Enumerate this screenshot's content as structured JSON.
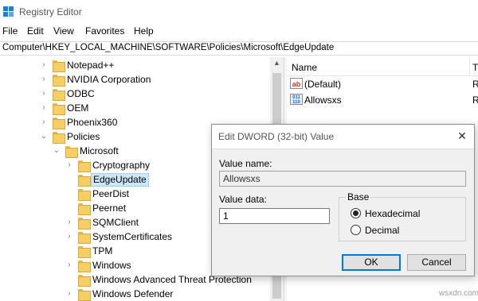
{
  "window": {
    "title": "Registry Editor"
  },
  "menu": [
    "File",
    "Edit",
    "View",
    "Favorites",
    "Help"
  ],
  "address": "Computer\\HKEY_LOCAL_MACHINE\\SOFTWARE\\Policies\\Microsoft\\EdgeUpdate",
  "tree": [
    {
      "label": "Notepad++",
      "level": 1,
      "expander": "collapsed"
    },
    {
      "label": "NVIDIA Corporation",
      "level": 1,
      "expander": "collapsed"
    },
    {
      "label": "ODBC",
      "level": 1,
      "expander": "collapsed"
    },
    {
      "label": "OEM",
      "level": 1,
      "expander": "collapsed"
    },
    {
      "label": "Phoenix360",
      "level": 1,
      "expander": "collapsed"
    },
    {
      "label": "Policies",
      "level": 1,
      "expander": "expanded"
    },
    {
      "label": "Microsoft",
      "level": 2,
      "expander": "expanded"
    },
    {
      "label": "Cryptography",
      "level": 3,
      "expander": "collapsed"
    },
    {
      "label": "EdgeUpdate",
      "level": 3,
      "expander": "none",
      "selected": true
    },
    {
      "label": "PeerDist",
      "level": 3,
      "expander": "none"
    },
    {
      "label": "Peernet",
      "level": 3,
      "expander": "none"
    },
    {
      "label": "SQMClient",
      "level": 3,
      "expander": "collapsed"
    },
    {
      "label": "SystemCertificates",
      "level": 3,
      "expander": "collapsed"
    },
    {
      "label": "TPM",
      "level": 3,
      "expander": "none"
    },
    {
      "label": "Windows",
      "level": 3,
      "expander": "collapsed"
    },
    {
      "label": "Windows Advanced Threat Protection",
      "level": 3,
      "expander": "none"
    },
    {
      "label": "Windows Defender",
      "level": 3,
      "expander": "collapsed"
    }
  ],
  "values_list": {
    "columns": {
      "name": "Name",
      "type": "Ty"
    },
    "rows": [
      {
        "icon": "string-value-icon",
        "icon_text": "ab",
        "name": "(Default)",
        "type": "R"
      },
      {
        "icon": "dword-value-icon",
        "icon_text": "011\n110",
        "name": "Allowsxs",
        "type": "R"
      }
    ]
  },
  "dialog": {
    "title": "Edit DWORD (32-bit) Value",
    "close_glyph": "✕",
    "value_name_label": "Value name:",
    "value_name": "Allowsxs",
    "value_data_label": "Value data:",
    "value_data": "1",
    "base_label": "Base",
    "base_options": [
      {
        "label": "Hexadecimal",
        "checked": true
      },
      {
        "label": "Decimal",
        "checked": false
      }
    ],
    "ok_label": "OK",
    "cancel_label": "Cancel"
  },
  "watermark": "wsxdn.com",
  "colors": {
    "selection": "#cce8ff",
    "folder": "#f5cf63",
    "accent": "#0078d7"
  }
}
